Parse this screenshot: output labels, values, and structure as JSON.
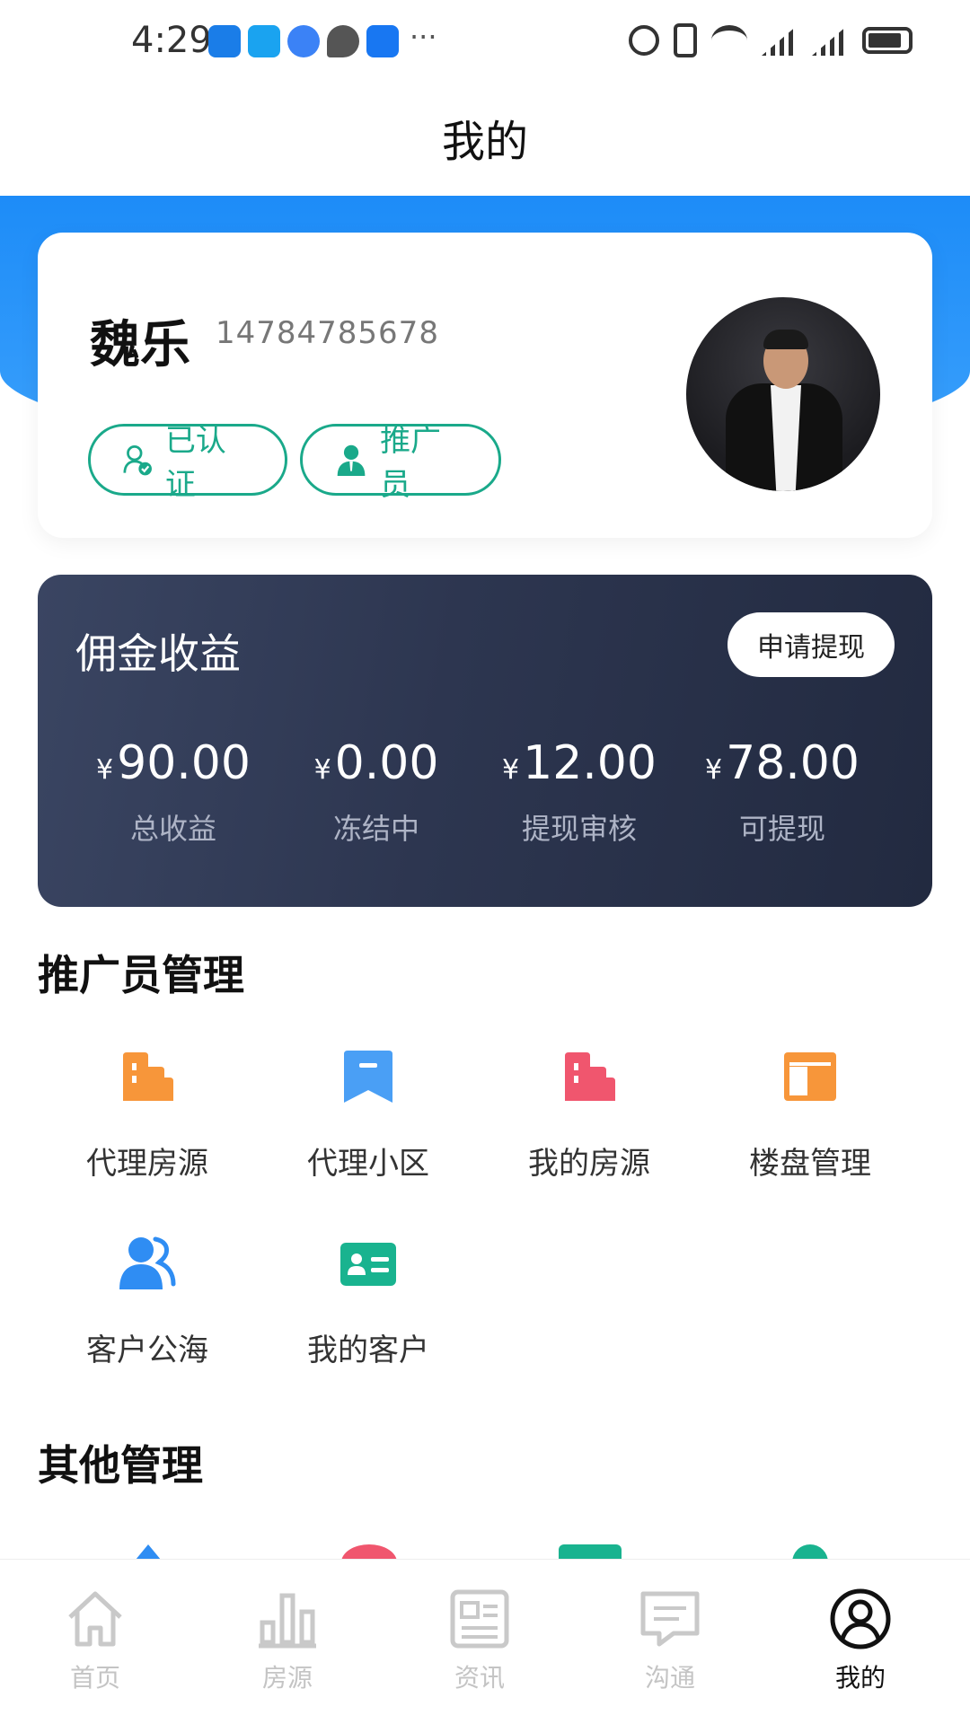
{
  "status_bar": {
    "time": "4:29",
    "more": "···"
  },
  "header": {
    "title": "我的"
  },
  "profile": {
    "name": "魏乐",
    "phone": "14784785678",
    "tags": [
      {
        "label": "已认证"
      },
      {
        "label": "推广员"
      }
    ]
  },
  "commission": {
    "title": "佣金收益",
    "withdraw_label": "申请提现",
    "currency": "¥",
    "stats": [
      {
        "amount": "90.00",
        "label": "总收益"
      },
      {
        "amount": "0.00",
        "label": "冻结中"
      },
      {
        "amount": "12.00",
        "label": "提现审核"
      },
      {
        "amount": "78.00",
        "label": "可提现"
      }
    ]
  },
  "promoter_section": {
    "title": "推广员管理",
    "items": [
      {
        "label": "代理房源",
        "icon": "building-icon",
        "color": "#f7963a"
      },
      {
        "label": "代理小区",
        "icon": "bookmark-icon",
        "color": "#4a9ff5"
      },
      {
        "label": "我的房源",
        "icon": "building-icon",
        "color": "#f0566e"
      },
      {
        "label": "楼盘管理",
        "icon": "layout-icon",
        "color": "#f7963a"
      },
      {
        "label": "客户公海",
        "icon": "users-icon",
        "color": "#2f8df3"
      },
      {
        "label": "我的客户",
        "icon": "id-card-icon",
        "color": "#19b38f"
      }
    ]
  },
  "other_section": {
    "title": "其他管理"
  },
  "bottom_nav": {
    "items": [
      {
        "label": "首页",
        "icon": "home-icon"
      },
      {
        "label": "房源",
        "icon": "bar-chart-icon"
      },
      {
        "label": "资讯",
        "icon": "news-icon"
      },
      {
        "label": "沟通",
        "icon": "message-icon"
      },
      {
        "label": "我的",
        "icon": "user-circle-icon"
      }
    ],
    "active_index": 4
  }
}
